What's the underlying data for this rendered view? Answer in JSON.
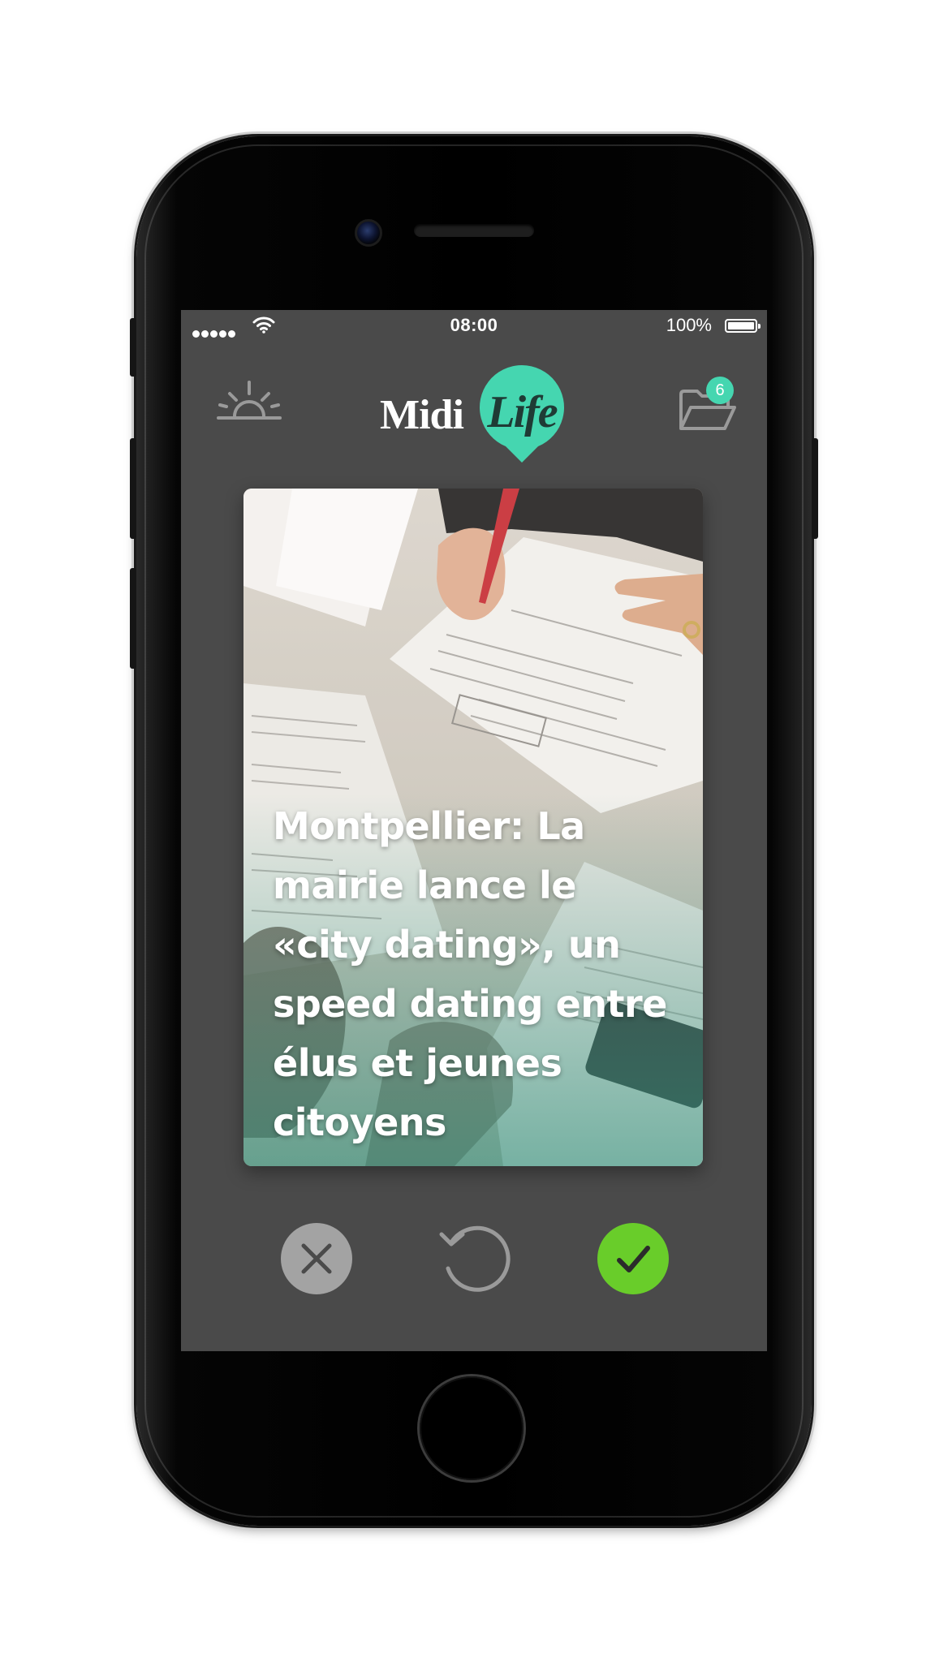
{
  "status_bar": {
    "time": "08:00",
    "battery_percent": "100%",
    "signal_dots": 5
  },
  "header": {
    "left_icon": "sunrise-icon",
    "logo": {
      "word1": "Midi",
      "word2": "Life"
    },
    "right_icon": "folder-icon",
    "badge_count": "6"
  },
  "card": {
    "title": "Montpellier: La mairie lance le «city dating», un speed dating entre élus et jeunes citoyens",
    "image": "photo-of-hands-signing-documents"
  },
  "actions": {
    "reject_icon": "close-icon",
    "undo_icon": "undo-icon",
    "accept_icon": "check-icon"
  },
  "colors": {
    "screen_bg": "#4a4a4a",
    "accent": "#45d6b0",
    "accept": "#69cd2a",
    "reject": "#a3a3a3"
  }
}
